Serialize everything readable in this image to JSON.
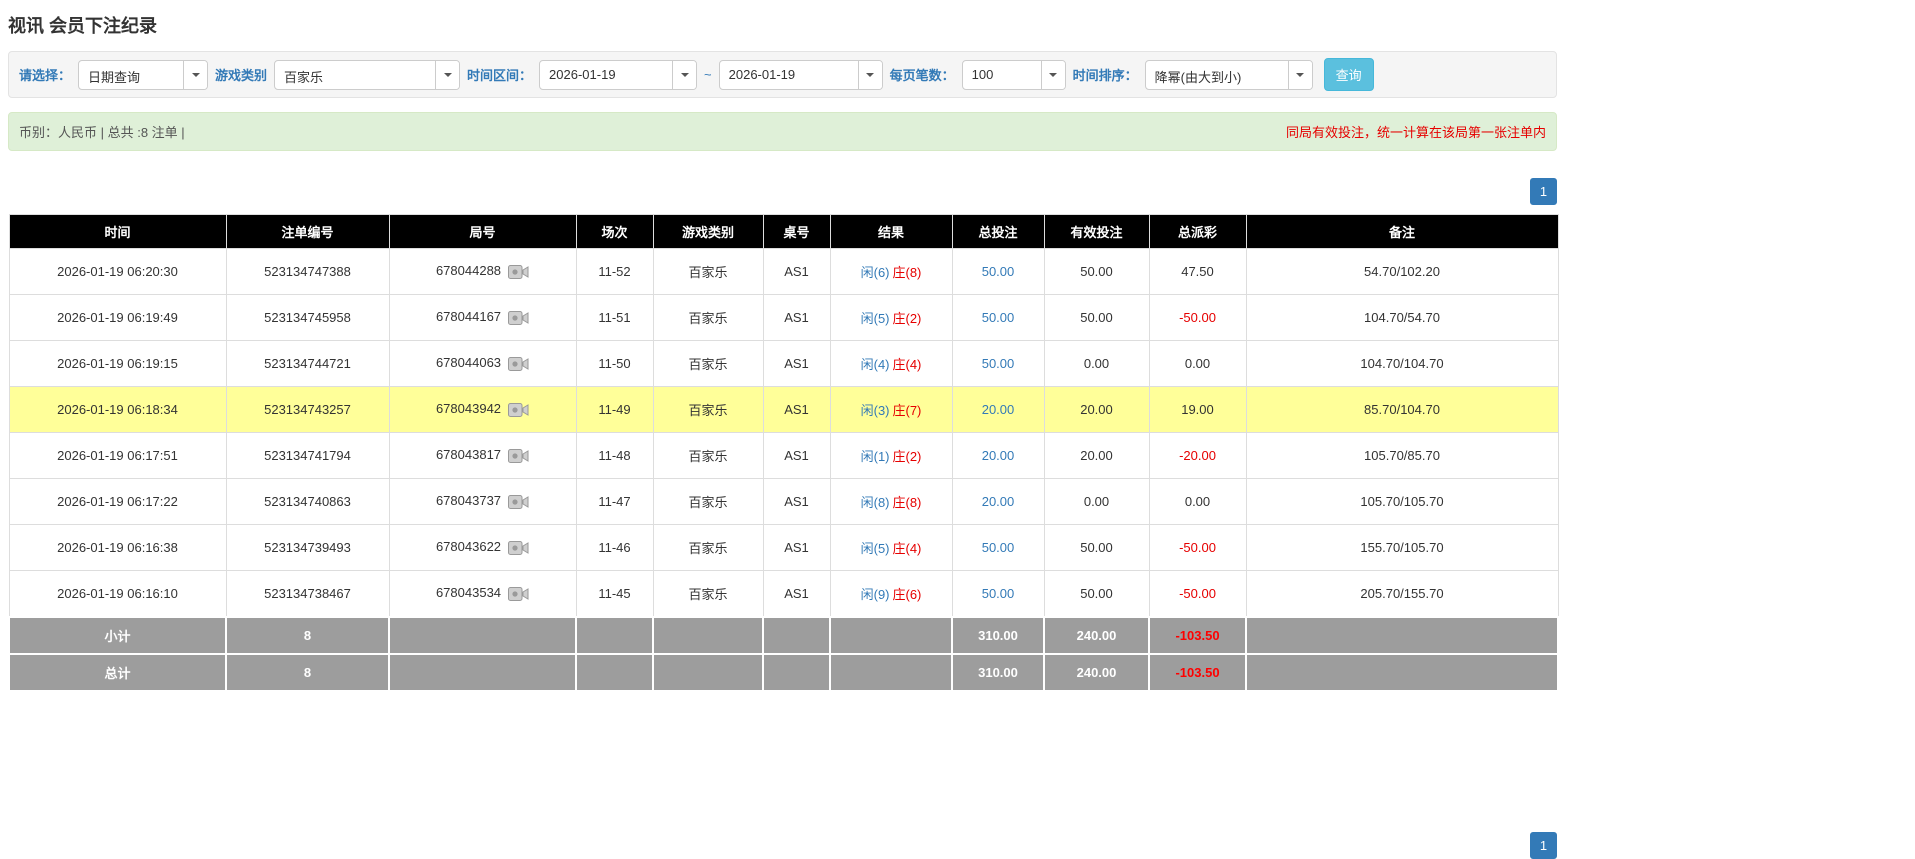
{
  "colors": {
    "accent_blue": "#337ab7",
    "search_button_blue": "#5bc0de",
    "negative_red": "#e60000",
    "highlight_yellow": "#ffff99",
    "header_black": "#000000",
    "footer_gray": "#9d9d9d",
    "summary_green": "#dff0d8"
  },
  "icons": {
    "dropdown_caret": "chevron-down",
    "round_media_icon": "video-camera"
  },
  "page": {
    "title": "视讯 会员下注纪录"
  },
  "filters": {
    "select_label": "请选择：",
    "select_value": "日期查询",
    "game_type_label": "游戏类别",
    "game_type_value": "百家乐",
    "time_range_label": "时间区间：",
    "date_from": "2026-01-19",
    "range_separator": "~",
    "date_to": "2026-01-19",
    "page_size_label": "每页笔数：",
    "page_size_value": "100",
    "sort_label": "时间排序：",
    "sort_value": "降幂(由大到小)",
    "search_button_label": "查询"
  },
  "summary": {
    "currency_info": "币别：人民币 | 总共 :8 注单 |",
    "notice": "同局有效投注，统一计算在该局第一张注单内"
  },
  "pagination": {
    "page_label": "1"
  },
  "table": {
    "headers": [
      "时间",
      "注单编号",
      "局号",
      "场次",
      "游戏类别",
      "桌号",
      "结果",
      "总投注",
      "有效投注",
      "总派彩",
      "备注"
    ],
    "rows": [
      {
        "time": "2026-01-19 06:20:30",
        "bet_id": "523134747388",
        "round_id": "678044288",
        "session": "11-52",
        "game": "百家乐",
        "table_no": "AS1",
        "result_player": "闲(6)",
        "result_banker": "庄(8)",
        "total_bet": "50.00",
        "valid_bet": "50.00",
        "payout": "47.50",
        "remark": "54.70/102.20",
        "highlight": false
      },
      {
        "time": "2026-01-19 06:19:49",
        "bet_id": "523134745958",
        "round_id": "678044167",
        "session": "11-51",
        "game": "百家乐",
        "table_no": "AS1",
        "result_player": "闲(5)",
        "result_banker": "庄(2)",
        "total_bet": "50.00",
        "valid_bet": "50.00",
        "payout": "-50.00",
        "remark": "104.70/54.70",
        "highlight": false
      },
      {
        "time": "2026-01-19 06:19:15",
        "bet_id": "523134744721",
        "round_id": "678044063",
        "session": "11-50",
        "game": "百家乐",
        "table_no": "AS1",
        "result_player": "闲(4)",
        "result_banker": "庄(4)",
        "total_bet": "50.00",
        "valid_bet": "0.00",
        "payout": "0.00",
        "remark": "104.70/104.70",
        "highlight": false
      },
      {
        "time": "2026-01-19 06:18:34",
        "bet_id": "523134743257",
        "round_id": "678043942",
        "session": "11-49",
        "game": "百家乐",
        "table_no": "AS1",
        "result_player": "闲(3)",
        "result_banker": "庄(7)",
        "total_bet": "20.00",
        "valid_bet": "20.00",
        "payout": "19.00",
        "remark": "85.70/104.70",
        "highlight": true
      },
      {
        "time": "2026-01-19 06:17:51",
        "bet_id": "523134741794",
        "round_id": "678043817",
        "session": "11-48",
        "game": "百家乐",
        "table_no": "AS1",
        "result_player": "闲(1)",
        "result_banker": "庄(2)",
        "total_bet": "20.00",
        "valid_bet": "20.00",
        "payout": "-20.00",
        "remark": "105.70/85.70",
        "highlight": false
      },
      {
        "time": "2026-01-19 06:17:22",
        "bet_id": "523134740863",
        "round_id": "678043737",
        "session": "11-47",
        "game": "百家乐",
        "table_no": "AS1",
        "result_player": "闲(8)",
        "result_banker": "庄(8)",
        "total_bet": "20.00",
        "valid_bet": "0.00",
        "payout": "0.00",
        "remark": "105.70/105.70",
        "highlight": false
      },
      {
        "time": "2026-01-19 06:16:38",
        "bet_id": "523134739493",
        "round_id": "678043622",
        "session": "11-46",
        "game": "百家乐",
        "table_no": "AS1",
        "result_player": "闲(5)",
        "result_banker": "庄(4)",
        "total_bet": "50.00",
        "valid_bet": "50.00",
        "payout": "-50.00",
        "remark": "155.70/105.70",
        "highlight": false
      },
      {
        "time": "2026-01-19 06:16:10",
        "bet_id": "523134738467",
        "round_id": "678043534",
        "session": "11-45",
        "game": "百家乐",
        "table_no": "AS1",
        "result_player": "闲(9)",
        "result_banker": "庄(6)",
        "total_bet": "50.00",
        "valid_bet": "50.00",
        "payout": "-50.00",
        "remark": "205.70/155.70",
        "highlight": false
      }
    ],
    "subtotal": {
      "label": "小计",
      "count": "8",
      "total_bet": "310.00",
      "valid_bet": "240.00",
      "payout": "-103.50"
    },
    "total": {
      "label": "总计",
      "count": "8",
      "total_bet": "310.00",
      "valid_bet": "240.00",
      "payout": "-103.50"
    }
  }
}
